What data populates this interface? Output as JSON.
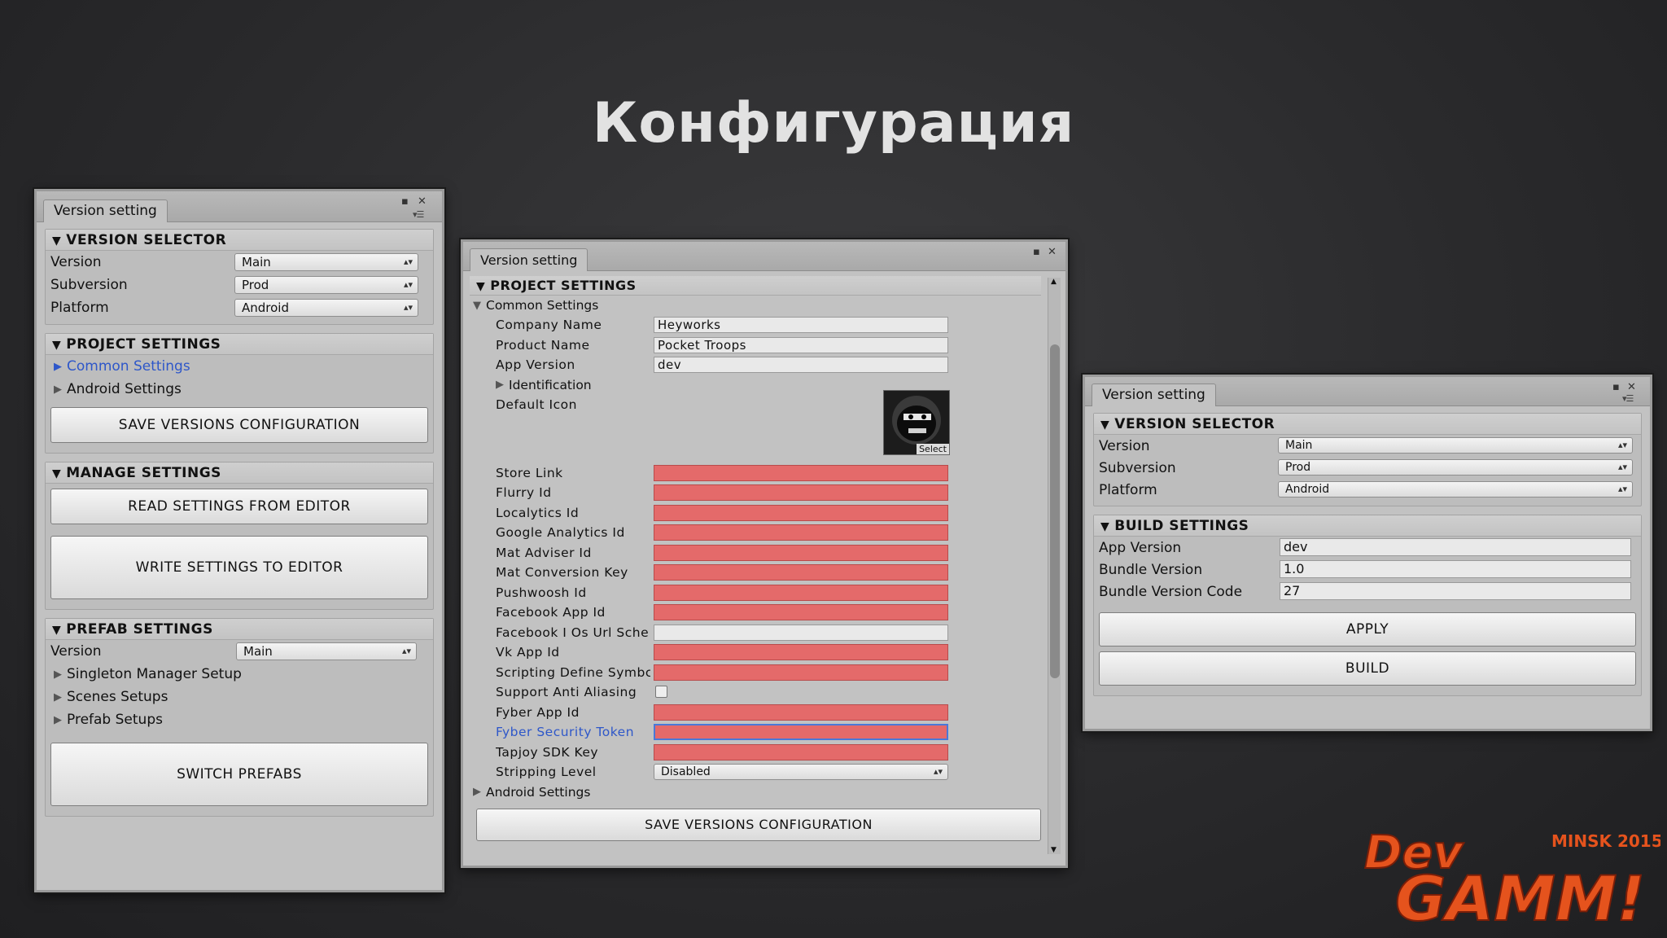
{
  "slide_title": "Конфигурация",
  "window_title": "Version setting",
  "left": {
    "version_selector": {
      "header": "VERSION SELECTOR",
      "version_label": "Version",
      "version_value": "Main",
      "subversion_label": "Subversion",
      "subversion_value": "Prod",
      "platform_label": "Platform",
      "platform_value": "Android"
    },
    "project_settings": {
      "header": "PROJECT SETTINGS",
      "common": "Common Settings",
      "android": "Android Settings",
      "save_button": "SAVE VERSIONS CONFIGURATION"
    },
    "manage_settings": {
      "header": "MANAGE SETTINGS",
      "read_button": "READ SETTINGS FROM EDITOR",
      "write_button": "WRITE SETTINGS TO EDITOR"
    },
    "prefab_settings": {
      "header": "PREFAB SETTINGS",
      "version_label": "Version",
      "version_value": "Main",
      "singleton": "Singleton Manager Setup",
      "scenes": "Scenes Setups",
      "prefabs": "Prefab Setups",
      "switch_button": "SWITCH PREFABS"
    }
  },
  "middle": {
    "project_header": "PROJECT SETTINGS",
    "common_foldout": "Common Settings",
    "company_name_label": "Company Name",
    "company_name_value": "Heyworks",
    "product_name_label": "Product Name",
    "product_name_value": "Pocket Troops",
    "app_version_label": "App Version",
    "app_version_value": "dev",
    "identification": "Identification",
    "default_icon_label": "Default Icon",
    "icon_select": "Select",
    "store_link": "Store Link",
    "flurry_id": "Flurry Id",
    "localytics_id": "Localytics Id",
    "google_analytics_id": "Google Analytics Id",
    "mat_adviser_id": "Mat Adviser Id",
    "mat_conversion_key": "Mat Conversion Key",
    "pushwoosh_id": "Pushwoosh Id",
    "facebook_app_id": "Facebook App Id",
    "facebook_ios_url": "Facebook I Os Url Sche",
    "vk_app_id": "Vk App Id",
    "scripting_define": "Scripting Define Symbc",
    "support_aa": "Support Anti Aliasing",
    "fyber_app_id": "Fyber App Id",
    "fyber_token": "Fyber Security Token",
    "tapjoy_key": "Tapjoy SDK Key",
    "stripping_label": "Stripping Level",
    "stripping_value": "Disabled",
    "android_foldout": "Android Settings",
    "save_button": "SAVE VERSIONS CONFIGURATION"
  },
  "right": {
    "version_selector": {
      "header": "VERSION SELECTOR",
      "version_label": "Version",
      "version_value": "Main",
      "subversion_label": "Subversion",
      "subversion_value": "Prod",
      "platform_label": "Platform",
      "platform_value": "Android"
    },
    "build_settings": {
      "header": "BUILD SETTINGS",
      "app_version_label": "App Version",
      "app_version_value": "dev",
      "bundle_version_label": "Bundle Version",
      "bundle_version_value": "1.0",
      "bundle_code_label": "Bundle Version Code",
      "bundle_code_value": "27",
      "apply_button": "APPLY",
      "build_button": "BUILD"
    }
  },
  "logo": {
    "brand_top": "Dev",
    "brand_bottom": "GAMM!",
    "event": "MINSK 2015"
  },
  "colors": {
    "red_field": "#e46a6a",
    "link_blue": "#2e57c9",
    "logo_orange": "#e5531d"
  }
}
